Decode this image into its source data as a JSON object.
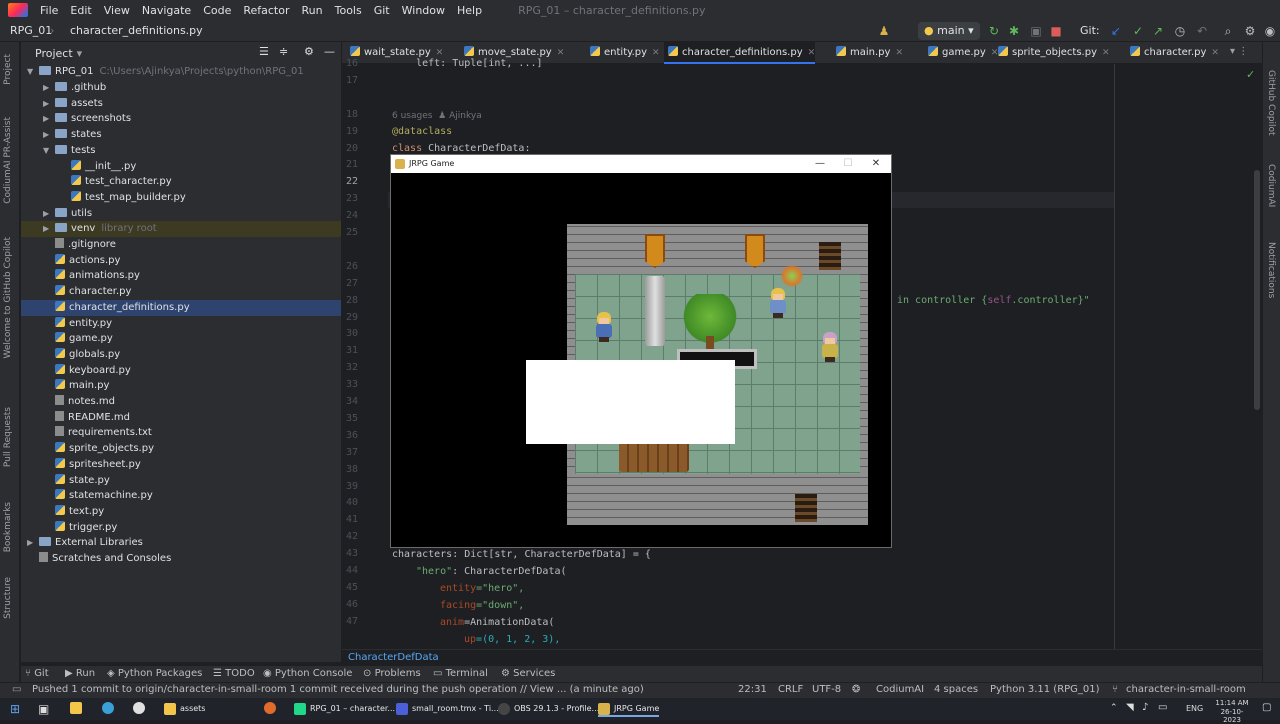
{
  "menubar": {
    "items": [
      "File",
      "Edit",
      "View",
      "Navigate",
      "Code",
      "Refactor",
      "Run",
      "Tools",
      "Git",
      "Window",
      "Help"
    ],
    "window_title": "RPG_01 – character_definitions.py"
  },
  "navbar": {
    "project": "RPG_01",
    "file": "character_definitions.py",
    "run_config": "main",
    "git_label": "Git:"
  },
  "left_tools": [
    "Project",
    "CodiumAI PR-Assist",
    "Welcome to GitHub Copilot",
    "Pull Requests",
    "Bookmarks",
    "Structure"
  ],
  "right_tools": [
    "GitHub Copilot",
    "CodiumAI",
    "Notifications"
  ],
  "project": {
    "title": "Project",
    "root_name": "RPG_01",
    "root_path": "C:\\Users\\Ajinkya\\Projects\\python\\RPG_01",
    "tree": [
      {
        "name": ".github",
        "kind": "folder",
        "level": 1,
        "arrow": "▶"
      },
      {
        "name": "assets",
        "kind": "folder",
        "level": 1,
        "arrow": "▶"
      },
      {
        "name": "screenshots",
        "kind": "folder",
        "level": 1,
        "arrow": "▶"
      },
      {
        "name": "states",
        "kind": "folder",
        "level": 1,
        "arrow": "▶"
      },
      {
        "name": "tests",
        "kind": "folder",
        "level": 1,
        "arrow": "▼"
      },
      {
        "name": "__init__.py",
        "kind": "py",
        "level": 2
      },
      {
        "name": "test_character.py",
        "kind": "py",
        "level": 2
      },
      {
        "name": "test_map_builder.py",
        "kind": "py",
        "level": 2
      },
      {
        "name": "utils",
        "kind": "folder",
        "level": 1,
        "arrow": "▶"
      },
      {
        "name": "venv",
        "kind": "folder",
        "level": 1,
        "arrow": "▶",
        "note": "library root",
        "excluded": true
      },
      {
        "name": ".gitignore",
        "kind": "txt",
        "level": 1
      },
      {
        "name": "actions.py",
        "kind": "py",
        "level": 1
      },
      {
        "name": "animations.py",
        "kind": "py",
        "level": 1
      },
      {
        "name": "character.py",
        "kind": "py",
        "level": 1
      },
      {
        "name": "character_definitions.py",
        "kind": "py",
        "level": 1,
        "selected": true
      },
      {
        "name": "entity.py",
        "kind": "py",
        "level": 1
      },
      {
        "name": "game.py",
        "kind": "py",
        "level": 1
      },
      {
        "name": "globals.py",
        "kind": "py",
        "level": 1
      },
      {
        "name": "keyboard.py",
        "kind": "py",
        "level": 1
      },
      {
        "name": "main.py",
        "kind": "py",
        "level": 1
      },
      {
        "name": "notes.md",
        "kind": "txt",
        "level": 1
      },
      {
        "name": "README.md",
        "kind": "txt",
        "level": 1
      },
      {
        "name": "requirements.txt",
        "kind": "txt",
        "level": 1
      },
      {
        "name": "sprite_objects.py",
        "kind": "py",
        "level": 1
      },
      {
        "name": "spritesheet.py",
        "kind": "py",
        "level": 1
      },
      {
        "name": "state.py",
        "kind": "py",
        "level": 1
      },
      {
        "name": "statemachine.py",
        "kind": "py",
        "level": 1
      },
      {
        "name": "text.py",
        "kind": "py",
        "level": 1
      },
      {
        "name": "trigger.py",
        "kind": "py",
        "level": 1
      },
      {
        "name": "External Libraries",
        "kind": "folder",
        "level": 0,
        "arrow": "▶"
      },
      {
        "name": "Scratches and Consoles",
        "kind": "txt",
        "level": 0
      }
    ]
  },
  "tabs": [
    "wait_state.py",
    "move_state.py",
    "entity.py",
    "character_definitions.py",
    "main.py",
    "game.py",
    "sprite_objects.py",
    "character.py"
  ],
  "active_tab": 3,
  "gutter": [
    "16",
    "17",
    "",
    "18",
    "19",
    "20",
    "21",
    "22",
    "23",
    "24",
    "25",
    "",
    "26",
    "27",
    "28",
    "29",
    "30",
    "31",
    "32",
    "33",
    "34",
    "35",
    "36",
    "37",
    "38",
    "39",
    "40",
    "41",
    "42",
    "43",
    "44",
    "45",
    "46",
    "47"
  ],
  "code": {
    "line16": "    left: Tuple[int, ...]",
    "usages": "6 usages",
    "author": "Ajinkya",
    "decorator": "@dataclass",
    "class_kw": "class ",
    "class_name": "CharacterDefData:",
    "fragment_a": "in controller {",
    "fragment_self": "self",
    "fragment_b": ".controller}\"",
    "chars_a": "characters",
    "chars_b": ": Dict[str, CharacterDefData] = {",
    "hero_key": "\"hero\"",
    "hero_rest": ": CharacterDefData(",
    "entity_prm": "entity",
    "entity_val": "=\"hero\",",
    "facing_prm": "facing",
    "facing_val": "=\"down\",",
    "anim_prm": "anim",
    "anim_val": "=AnimationData(",
    "up_prm": "up",
    "up_val": "=(0, 1, 2, 3),"
  },
  "breadcrumb": "CharacterDefData",
  "toolwindows": [
    "Git",
    "Run",
    "Python Packages",
    "TODO",
    "Python Console",
    "Problems",
    "Terminal",
    "Services"
  ],
  "status": {
    "message": "Pushed 1 commit to origin/character-in-small-room 1 commit received during the push operation // View ... (a minute ago)",
    "position": "22:31",
    "line_sep": "CRLF",
    "encoding": "UTF-8",
    "plugin": "CodiumAI",
    "indent": "4 spaces",
    "interpreter": "Python 3.11 (RPG_01)",
    "branch": "character-in-small-room"
  },
  "game_window": {
    "title": "JRPG Game",
    "minimize": "—",
    "maximize": "☐",
    "close": "✕"
  },
  "taskbar": {
    "apps": [
      "assets",
      "RPG_01 – character...",
      "small_room.tmx - Ti...",
      "OBS 29.1.3 - Profile...",
      "JRPG Game"
    ],
    "active_app": 4,
    "lang": "ENG",
    "time": "11:14 AM",
    "date": "26-10-2023"
  },
  "colors": {
    "accent": "#3574f0",
    "selection": "#2e436e",
    "run_green": "#5fb85a",
    "stop_red": "#db5c5c"
  }
}
